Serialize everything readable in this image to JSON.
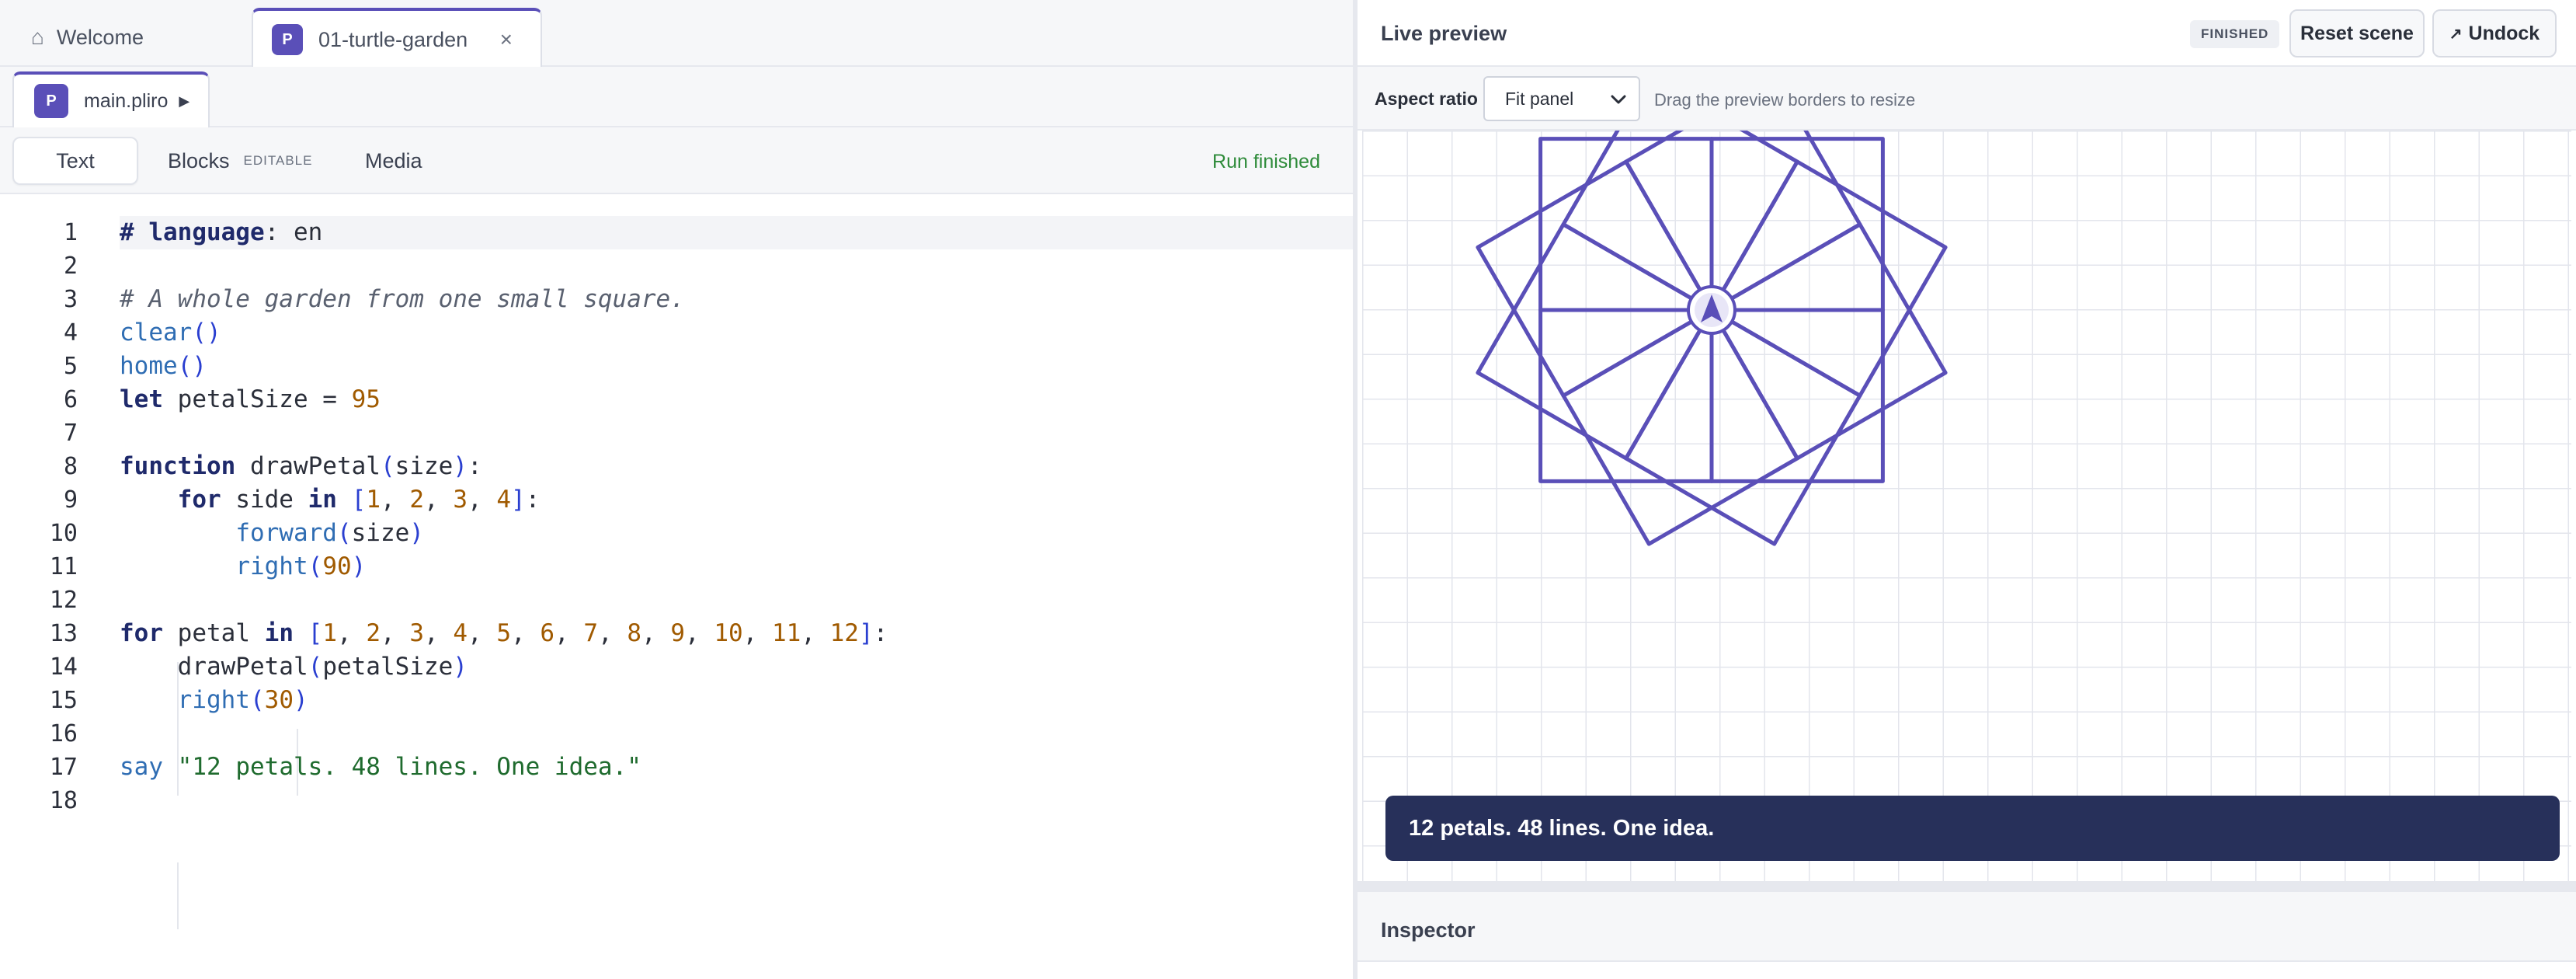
{
  "tabs": {
    "welcome": "Welcome",
    "active": "01-turtle-garden",
    "active_badge": "P",
    "close": "×"
  },
  "file": {
    "name": "main.pliro",
    "badge": "P"
  },
  "modes": {
    "text": "Text",
    "blocks": "Blocks",
    "blocks_tag": "EDITABLE",
    "media": "Media",
    "run_status": "Run finished"
  },
  "code": {
    "line_numbers": [
      "1",
      "2",
      "3",
      "4",
      "5",
      "6",
      "7",
      "8",
      "9",
      "10",
      "11",
      "12",
      "13",
      "14",
      "15",
      "16",
      "17",
      "18"
    ],
    "current_line": 1
  },
  "preview": {
    "title": "Live preview",
    "status": "FINISHED",
    "reset_label": "Reset scene",
    "undock_label": "Undock",
    "aspect_label": "Aspect ratio",
    "aspect_value": "Fit panel",
    "aspect_hint": "Drag the preview borders to resize",
    "say_text": "12 petals. 48 lines. One idea.",
    "accent_color": "#5a4fb8",
    "turtle": {
      "petals": 12,
      "petal_size": 95,
      "turn_degrees": 30
    }
  },
  "inspector": {
    "title": "Inspector"
  }
}
